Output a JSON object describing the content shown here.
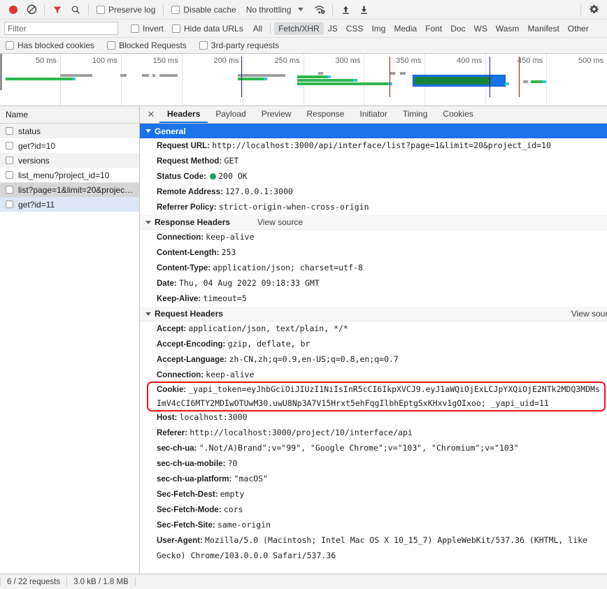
{
  "toolbar": {
    "record_icon": "record-circle-icon",
    "clear_icon": "clear-no-entry-icon",
    "filter_icon": "funnel-filter-icon",
    "search_icon": "search-magnifier-icon",
    "preserve_log_label": "Preserve log",
    "disable_cache_label": "Disable cache",
    "throttling_label": "No throttling",
    "throttle_caret_icon": "chevron-down-icon",
    "network_conditions_icon": "wifi-settings-icon",
    "import_har_icon": "upload-arrow-icon",
    "export_har_icon": "download-arrow-icon",
    "settings_icon": "gear-icon"
  },
  "filterbar": {
    "placeholder": "Filter",
    "value": "",
    "invert_label": "Invert",
    "hide_data_urls_label": "Hide data URLs",
    "types": [
      {
        "label": "All",
        "active": false
      },
      {
        "label": "Fetch/XHR",
        "active": true
      },
      {
        "label": "JS",
        "active": false
      },
      {
        "label": "CSS",
        "active": false
      },
      {
        "label": "Img",
        "active": false
      },
      {
        "label": "Media",
        "active": false
      },
      {
        "label": "Font",
        "active": false
      },
      {
        "label": "Doc",
        "active": false
      },
      {
        "label": "WS",
        "active": false
      },
      {
        "label": "Wasm",
        "active": false
      },
      {
        "label": "Manifest",
        "active": false
      },
      {
        "label": "Other",
        "active": false
      }
    ]
  },
  "blockbar": {
    "has_blocked_cookies_label": "Has blocked cookies",
    "blocked_requests_label": "Blocked Requests",
    "third_party_label": "3rd-party requests"
  },
  "overview": {
    "ticks": [
      "50 ms",
      "100 ms",
      "150 ms",
      "200 ms",
      "250 ms",
      "300 ms",
      "350 ms",
      "400 ms",
      "450 ms",
      "500 ms"
    ]
  },
  "sidebar": {
    "column_header": "Name",
    "rows": [
      {
        "name": "status",
        "state": "alt"
      },
      {
        "name": "get?id=10",
        "state": "normal"
      },
      {
        "name": "versions",
        "state": "alt"
      },
      {
        "name": "list_menu?project_id=10",
        "state": "normal"
      },
      {
        "name": "list?page=1&limit=20&projec…",
        "state": "selected"
      },
      {
        "name": "get?id=11",
        "state": "lastsel"
      }
    ]
  },
  "tabs": {
    "close_label": "✕",
    "items": [
      {
        "label": "Headers",
        "active": true
      },
      {
        "label": "Payload",
        "active": false
      },
      {
        "label": "Preview",
        "active": false
      },
      {
        "label": "Response",
        "active": false
      },
      {
        "label": "Initiator",
        "active": false
      },
      {
        "label": "Timing",
        "active": false
      },
      {
        "label": "Cookies",
        "active": false
      }
    ]
  },
  "headers": {
    "general": {
      "title": "General",
      "rows": [
        {
          "key": "Request URL:",
          "value": "http://localhost:3000/api/interface/list?page=1&limit=20&project_id=10"
        },
        {
          "key": "Request Method:",
          "value": "GET"
        },
        {
          "key": "Status Code:",
          "value": "200 OK",
          "status_dot": true
        },
        {
          "key": "Remote Address:",
          "value": "127.0.0.1:3000"
        },
        {
          "key": "Referrer Policy:",
          "value": "strict-origin-when-cross-origin"
        }
      ]
    },
    "response": {
      "title": "Response Headers",
      "view_source": "View source",
      "rows": [
        {
          "key": "Connection:",
          "value": "keep-alive"
        },
        {
          "key": "Content-Length:",
          "value": "253"
        },
        {
          "key": "Content-Type:",
          "value": "application/json; charset=utf-8"
        },
        {
          "key": "Date:",
          "value": "Thu, 04 Aug 2022 09:18:33 GMT"
        },
        {
          "key": "Keep-Alive:",
          "value": "timeout=5"
        }
      ]
    },
    "request": {
      "title": "Request Headers",
      "view_source": "View source",
      "rows": [
        {
          "key": "Accept:",
          "value": "application/json, text/plain, */*"
        },
        {
          "key": "Accept-Encoding:",
          "value": "gzip, deflate, br"
        },
        {
          "key": "Accept-Language:",
          "value": "zh-CN,zh;q=0.9,en-US;q=0.8,en;q=0.7"
        },
        {
          "key": "Connection:",
          "value": "keep-alive"
        }
      ],
      "cookie": {
        "key": "Cookie:",
        "value": "_yapi_token=eyJhbGciOiJIUzI1NiIsInR5cCI6IkpXVCJ9.eyJ1aWQiOjExLCJpYXQiOjE2NTk2MDQ3MDMsImV4cCI6MTY2MDIwOTUwM30.uwU8Np3A7V15Hrxt5ehFqgIlbhEptgSxKHxv1gOIxoo; _yapi_uid=11",
        "highlighted": true,
        "highlight_color": "#ee1111"
      },
      "rows_after": [
        {
          "key": "Host:",
          "value": "localhost:3000"
        },
        {
          "key": "Referer:",
          "value": "http://localhost:3000/project/10/interface/api"
        },
        {
          "key": "sec-ch-ua:",
          "value": "\".Not/A)Brand\";v=\"99\", \"Google Chrome\";v=\"103\", \"Chromium\";v=\"103\""
        },
        {
          "key": "sec-ch-ua-mobile:",
          "value": "?0"
        },
        {
          "key": "sec-ch-ua-platform:",
          "value": "\"macOS\""
        },
        {
          "key": "Sec-Fetch-Dest:",
          "value": "empty"
        },
        {
          "key": "Sec-Fetch-Mode:",
          "value": "cors"
        },
        {
          "key": "Sec-Fetch-Site:",
          "value": "same-origin"
        },
        {
          "key": "User-Agent:",
          "value": "Mozilla/5.0 (Macintosh; Intel Mac OS X 10_15_7) AppleWebKit/537.36 (KHTML, like Gecko) Chrome/103.0.0.0 Safari/537.36"
        }
      ]
    }
  },
  "statusbar": {
    "requests": "6 / 22 requests",
    "transferred": "3.0 kB / 1.8 MB"
  }
}
